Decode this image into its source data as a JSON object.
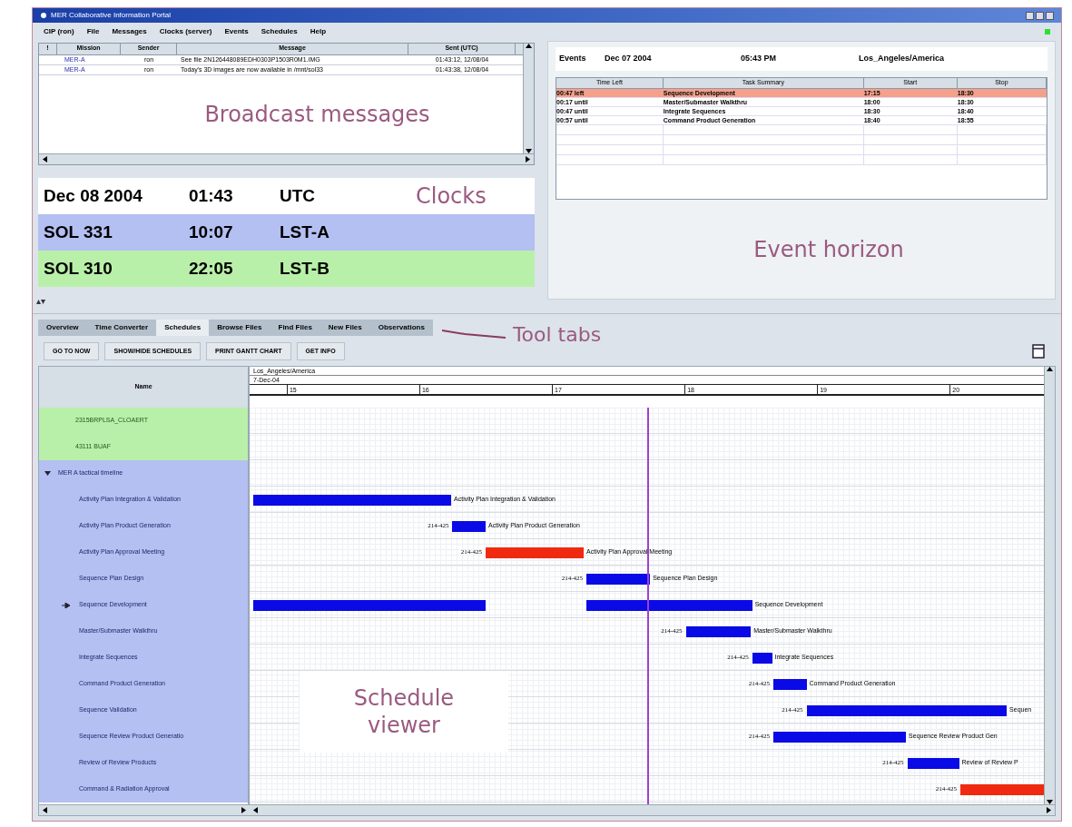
{
  "window": {
    "title": "MER Collaborative Information Portal"
  },
  "menu": [
    "CIP (ron)",
    "File",
    "Messages",
    "Clocks (server)",
    "Events",
    "Schedules",
    "Help"
  ],
  "messages": {
    "columns": [
      "!",
      "Mission",
      "Sender",
      "Message",
      "Sent (UTC)"
    ],
    "rows": [
      {
        "mission": "MER-A",
        "sender": "ron",
        "message": "See file 2N126448089EDH0303P1503R0M1.IMG",
        "sent": "01:43:12, 12/08/04"
      },
      {
        "mission": "MER-A",
        "sender": "ron",
        "message": "Today's 3D images are now available in /mnt/sol33",
        "sent": "01:43:38, 12/08/04"
      }
    ],
    "annotation": "Broadcast messages"
  },
  "clocks": {
    "rows": [
      {
        "date": "Dec 08 2004",
        "time": "01:43",
        "zone": "UTC",
        "color": "#ffffff"
      },
      {
        "date": "SOL 331",
        "time": "10:07",
        "zone": "LST-A",
        "color": "#b4bff2"
      },
      {
        "date": "SOL 310",
        "time": "22:05",
        "zone": "LST-B",
        "color": "#b9f0a9"
      }
    ],
    "annotation": "Clocks"
  },
  "events": {
    "label": "Events",
    "date": "Dec 07 2004",
    "time": "05:43 PM",
    "zone": "Los_Angeles/America",
    "columns": [
      "Time Left",
      "Task Summary",
      "Start",
      "Stop"
    ],
    "rows": [
      {
        "left": "00:47 left",
        "task": "Sequence Development",
        "start": "17:15",
        "stop": "18:30",
        "selected": true
      },
      {
        "left": "00:17 until",
        "task": "Master/Submaster Walkthru",
        "start": "18:00",
        "stop": "18:30",
        "selected": false
      },
      {
        "left": "00:47 until",
        "task": "Integrate Sequences",
        "start": "18:30",
        "stop": "18:40",
        "selected": false
      },
      {
        "left": "00:57 until",
        "task": "Command Product Generation",
        "start": "18:40",
        "stop": "18:55",
        "selected": false
      }
    ],
    "annotation": "Event horizon"
  },
  "tabs": [
    {
      "label": "Overview",
      "selected": false
    },
    {
      "label": "Time Converter",
      "selected": false
    },
    {
      "label": "Schedules",
      "selected": true
    },
    {
      "label": "Browse Files",
      "selected": false
    },
    {
      "label": "Find Files",
      "selected": false
    },
    {
      "label": "New Files",
      "selected": false
    },
    {
      "label": "Observations",
      "selected": false
    }
  ],
  "tabs_annotation": "Tool tabs",
  "toolbar": [
    "GO TO NOW",
    "SHOW/HIDE SCHEDULES",
    "PRINT GANTT CHART",
    "GET INFO"
  ],
  "gantt": {
    "name_header": "Name",
    "zone": "Los_Angeles/America",
    "date": "7-Dec-04",
    "annotation": "Schedule viewer",
    "ticks": [
      "15",
      "16",
      "17",
      "18",
      "19",
      "20"
    ],
    "rows": [
      {
        "kind": "schedule",
        "name": "2315BRPLSA_CLOAERT",
        "color": "#b9f0a9"
      },
      {
        "kind": "schedule",
        "name": "43111 BUAF",
        "color": "#b9f0a9"
      },
      {
        "kind": "group",
        "name": "MER A tactical timeline",
        "color": "#b4bff2",
        "expanded": true
      },
      {
        "kind": "task",
        "name": "Activity Plan Integration & Validation",
        "color": "#b4bff2",
        "bars": [
          {
            "color": "#0a0ae6"
          }
        ],
        "current": false,
        "post": "Activity Plan Integration & Validation"
      },
      {
        "kind": "task",
        "name": "Activity Plan Product Generation",
        "color": "#b4bff2",
        "bars": [
          {
            "color": "#0a0ae6"
          }
        ],
        "current": false,
        "pre": "214-425",
        "post": "Activity Plan Product Generation"
      },
      {
        "kind": "task",
        "name": "Activity Plan Approval Meeting",
        "color": "#b4bff2",
        "bars": [
          {
            "color": "#f02a10"
          }
        ],
        "current": false,
        "pre": "214-425",
        "post": "Activity Plan Approval Meeting"
      },
      {
        "kind": "task",
        "name": "Sequence Plan Design",
        "color": "#b4bff2",
        "bars": [
          {
            "color": "#0a0ae6"
          }
        ],
        "current": false,
        "pre": "214-425",
        "post": "Sequence Plan Design"
      },
      {
        "kind": "task",
        "name": "Sequence Development",
        "color": "#b4bff2",
        "bars": [
          {
            "color": "#0a0ae6"
          },
          {
            "color": "#0a0ae6"
          }
        ],
        "current": true,
        "post": "Sequence Development"
      },
      {
        "kind": "task",
        "name": "Master/Submaster Walkthru",
        "color": "#b4bff2",
        "bars": [
          {
            "color": "#0a0ae6"
          }
        ],
        "current": false,
        "pre": "214-425",
        "post": "Master/Submaster Walkthru"
      },
      {
        "kind": "task",
        "name": "Integrate Sequences",
        "color": "#b4bff2",
        "bars": [
          {
            "color": "#0a0ae6"
          }
        ],
        "current": false,
        "pre": "214-425",
        "post": "Integrate Sequences"
      },
      {
        "kind": "task",
        "name": "Command Product Generation",
        "color": "#b4bff2",
        "bars": [
          {
            "color": "#0a0ae6"
          }
        ],
        "current": false,
        "pre": "214-425",
        "post": "Command Product Generation"
      },
      {
        "kind": "task",
        "name": "Sequence Validation",
        "color": "#b4bff2",
        "bars": [
          {
            "color": "#0a0ae6"
          }
        ],
        "current": false,
        "pre": "214-425",
        "post": "Sequen"
      },
      {
        "kind": "task",
        "name": "Sequence Review Product Generatio",
        "color": "#b4bff2",
        "bars": [
          {
            "color": "#0a0ae6"
          }
        ],
        "current": false,
        "pre": "214-425",
        "post": "Sequence Review Product Gen"
      },
      {
        "kind": "task",
        "name": "Review of Review Products",
        "color": "#b4bff2",
        "bars": [
          {
            "color": "#0a0ae6"
          }
        ],
        "current": false,
        "pre": "214-425",
        "post": "Review of Review P"
      },
      {
        "kind": "task",
        "name": "Command & Radiation Approval",
        "color": "#b4bff2",
        "bars": [
          {
            "color": "#f02a10"
          }
        ],
        "current": false,
        "pre": "214-425"
      }
    ]
  }
}
